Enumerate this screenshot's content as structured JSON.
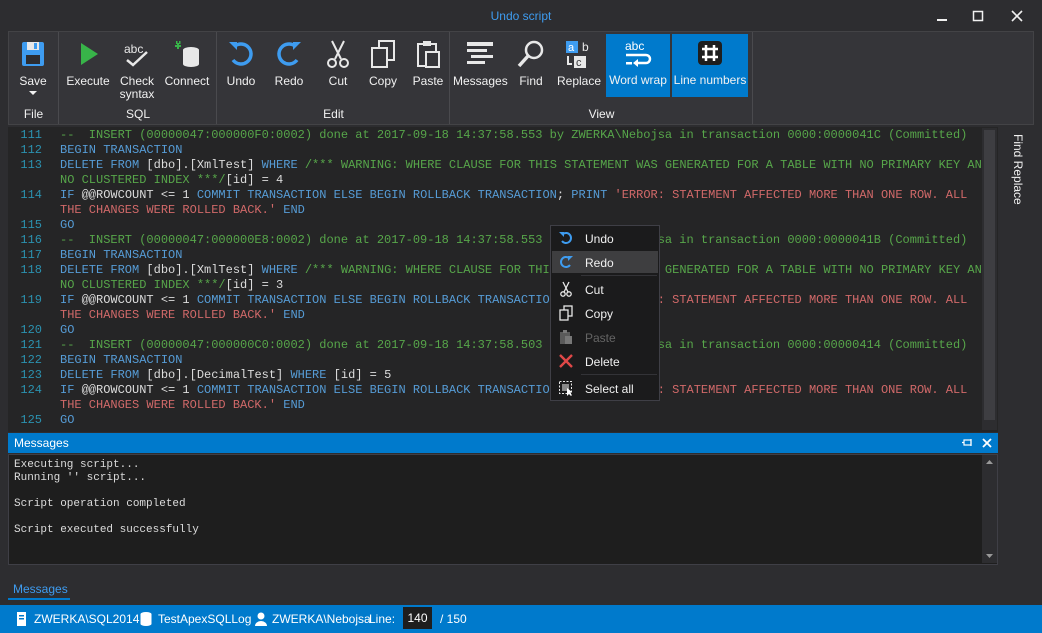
{
  "window": {
    "title": "Undo script"
  },
  "ribbon": {
    "groups": {
      "file": "File",
      "sql": "SQL",
      "edit": "Edit",
      "view": "View"
    },
    "buttons": {
      "save": "Save",
      "execute": "Execute",
      "check_syntax_1": "Check",
      "check_syntax_2": "syntax",
      "connect": "Connect",
      "undo": "Undo",
      "redo": "Redo",
      "cut": "Cut",
      "copy": "Copy",
      "paste": "Paste",
      "messages": "Messages",
      "find": "Find",
      "replace": "Replace",
      "word_wrap": "Word wrap",
      "line_numbers": "Line numbers"
    }
  },
  "editor": {
    "lines": [
      {
        "n": "111",
        "segs": [
          [
            "c",
            "--  INSERT (00000047:000000F0:0002) done at 2017-09-18 14:37:58.553 by ZWERKA\\Nebojsa in transaction 0000:0000041C (Committed)"
          ]
        ]
      },
      {
        "n": "112",
        "segs": [
          [
            "k",
            "BEGIN TRANSACTION"
          ]
        ]
      },
      {
        "n": "113",
        "segs": [
          [
            "k",
            "DELETE FROM "
          ],
          [
            "t",
            "[dbo].[XmlTest] "
          ],
          [
            "k",
            "WHERE "
          ],
          [
            "c",
            "/*** WARNING: WHERE CLAUSE FOR THIS STATEMENT WAS GENERATED FOR A TABLE WITH NO PRIMARY KEY AND"
          ]
        ]
      },
      {
        "n": "",
        "segs": [
          [
            "c",
            "NO CLUSTERED INDEX ***/"
          ],
          [
            "t",
            "[id] = 4"
          ]
        ]
      },
      {
        "n": "114",
        "segs": [
          [
            "k",
            "IF "
          ],
          [
            "t",
            "@@ROWCOUNT <= 1 "
          ],
          [
            "k",
            "COMMIT TRANSACTION ELSE BEGIN ROLLBACK TRANSACTION"
          ],
          [
            "t",
            "; "
          ],
          [
            "k",
            "PRINT "
          ],
          [
            "r",
            "'ERROR: STATEMENT AFFECTED MORE THAN ONE ROW. ALL"
          ]
        ]
      },
      {
        "n": "",
        "segs": [
          [
            "r",
            "THE CHANGES WERE ROLLED BACK.' "
          ],
          [
            "k",
            "END"
          ]
        ]
      },
      {
        "n": "115",
        "segs": [
          [
            "k",
            "GO"
          ]
        ]
      },
      {
        "n": "116",
        "segs": [
          [
            "c",
            "--  INSERT (00000047:000000E8:0002) done at 2017-09-18 14:37:58.553 by ZWERKA\\Nebojsa in transaction 0000:0000041B (Committed)"
          ]
        ]
      },
      {
        "n": "117",
        "segs": [
          [
            "k",
            "BEGIN TRANSACTION"
          ]
        ]
      },
      {
        "n": "118",
        "segs": [
          [
            "k",
            "DELETE FROM "
          ],
          [
            "t",
            "[dbo].[XmlTest] "
          ],
          [
            "k",
            "WHERE "
          ],
          [
            "c",
            "/*** WARNING: WHERE CLAUSE FOR THIS STATEMENT WAS GENERATED FOR A TABLE WITH NO PRIMARY KEY AND"
          ]
        ]
      },
      {
        "n": "",
        "segs": [
          [
            "c",
            "NO CLUSTERED INDEX ***/"
          ],
          [
            "t",
            "[id] = 3"
          ]
        ]
      },
      {
        "n": "119",
        "segs": [
          [
            "k",
            "IF "
          ],
          [
            "t",
            "@@ROWCOUNT <= 1 "
          ],
          [
            "k",
            "COMMIT TRANSACTION ELSE BEGIN ROLLBACK TRANSACTION"
          ],
          [
            "t",
            "; "
          ],
          [
            "k",
            "PRINT "
          ],
          [
            "r",
            "'ERROR: STATEMENT AFFECTED MORE THAN ONE ROW. ALL"
          ]
        ]
      },
      {
        "n": "",
        "segs": [
          [
            "r",
            "THE CHANGES WERE ROLLED BACK.' "
          ],
          [
            "k",
            "END"
          ]
        ]
      },
      {
        "n": "120",
        "segs": [
          [
            "k",
            "GO"
          ]
        ]
      },
      {
        "n": "121",
        "segs": [
          [
            "c",
            "--  INSERT (00000047:000000C0:0002) done at 2017-09-18 14:37:58.503 by ZWERKA\\Nebojsa in transaction 0000:00000414 (Committed)"
          ]
        ]
      },
      {
        "n": "122",
        "segs": [
          [
            "k",
            "BEGIN TRANSACTION"
          ]
        ]
      },
      {
        "n": "123",
        "segs": [
          [
            "k",
            "DELETE FROM "
          ],
          [
            "t",
            "[dbo].[DecimalTest] "
          ],
          [
            "k",
            "WHERE "
          ],
          [
            "t",
            "[id] = 5"
          ]
        ]
      },
      {
        "n": "124",
        "segs": [
          [
            "k",
            "IF "
          ],
          [
            "t",
            "@@ROWCOUNT <= 1 "
          ],
          [
            "k",
            "COMMIT TRANSACTION ELSE BEGIN ROLLBACK TRANSACTION"
          ],
          [
            "t",
            "; "
          ],
          [
            "k",
            "PRINT "
          ],
          [
            "r",
            "'ERROR: STATEMENT AFFECTED MORE THAN ONE ROW. ALL"
          ]
        ]
      },
      {
        "n": "",
        "segs": [
          [
            "r",
            "THE CHANGES WERE ROLLED BACK.' "
          ],
          [
            "k",
            "END"
          ]
        ]
      },
      {
        "n": "125",
        "segs": [
          [
            "k",
            "GO"
          ]
        ]
      }
    ]
  },
  "side_panel": {
    "find_replace": "Find  Replace"
  },
  "context_menu": {
    "undo": "Undo",
    "redo": "Redo",
    "cut": "Cut",
    "copy": "Copy",
    "paste": "Paste",
    "delete": "Delete",
    "select_all": "Select all"
  },
  "messages": {
    "title": "Messages",
    "lines": [
      "Executing script...",
      "Running '' script...",
      "",
      "Script operation completed",
      "",
      "Script executed successfully"
    ]
  },
  "bottom_tab": "Messages",
  "status": {
    "server": "ZWERKA\\SQL2014",
    "database": "TestApexSQLLog",
    "user": "ZWERKA\\Nebojsa",
    "line_label": "Line:",
    "line_value": "140",
    "line_total": "/ 150"
  },
  "colors": {
    "accent": "#007acc",
    "comment": "#57a64a",
    "keyword": "#569cd6",
    "string": "#d16969",
    "background": "#2d2d30"
  }
}
